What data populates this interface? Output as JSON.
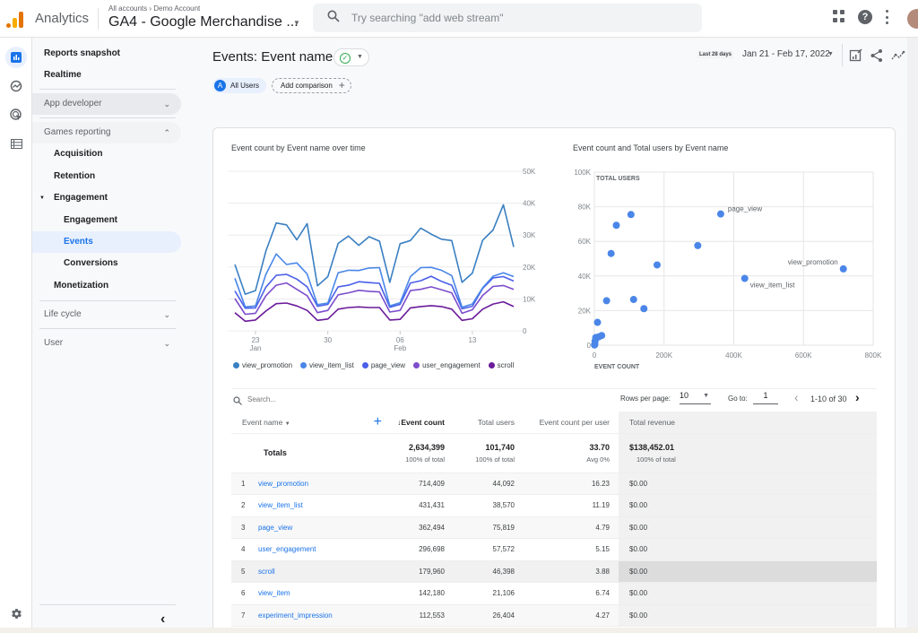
{
  "topbar": {
    "app_name": "Analytics",
    "breadcrumb": "All accounts › Demo Account",
    "property": "GA4 - Google Merchandise ...",
    "search_placeholder": "Try searching \"add web stream\"",
    "help_glyph": "?"
  },
  "rail": {
    "items": [
      {
        "icon": "reports-icon",
        "active": true
      },
      {
        "icon": "explore-icon",
        "active": false
      },
      {
        "icon": "advertising-icon",
        "active": false
      },
      {
        "icon": "configure-icon",
        "active": false
      }
    ],
    "settings_icon": "gear-icon"
  },
  "nav": {
    "reports_snapshot": "Reports snapshot",
    "realtime": "Realtime",
    "app_developer": "App developer",
    "games_reporting": "Games reporting",
    "acquisition": "Acquisition",
    "retention": "Retention",
    "engagement_group": "Engagement",
    "engagement": "Engagement",
    "events": "Events",
    "conversions": "Conversions",
    "monetization": "Monetization",
    "life_cycle": "Life cycle",
    "user": "User",
    "collapse_glyph": "‹"
  },
  "header": {
    "title": "Events: Event name",
    "segment_letter": "A",
    "segment": "All Users",
    "add_comparison": "Add comparison",
    "date_tag": "Last 28 days",
    "date_range": "Jan 21 - Feb 17, 2022"
  },
  "chart_data": [
    {
      "type": "line",
      "title": "Event count by Event name over time",
      "xlabel": "",
      "ylabel": "",
      "ylim": [
        0,
        50000
      ],
      "yticks": [
        "0",
        "10K",
        "20K",
        "30K",
        "40K",
        "50K"
      ],
      "xticks": [
        {
          "day_index": 2,
          "label": "23",
          "sub": "Jan"
        },
        {
          "day_index": 9,
          "label": "30",
          "sub": ""
        },
        {
          "day_index": 16,
          "label": "06",
          "sub": "Feb"
        },
        {
          "day_index": 23,
          "label": "13",
          "sub": ""
        }
      ],
      "x": [
        "Jan 21",
        "Jan 22",
        "Jan 23",
        "Jan 24",
        "Jan 25",
        "Jan 26",
        "Jan 27",
        "Jan 28",
        "Jan 29",
        "Jan 30",
        "Jan 31",
        "Feb 1",
        "Feb 2",
        "Feb 3",
        "Feb 4",
        "Feb 5",
        "Feb 6",
        "Feb 7",
        "Feb 8",
        "Feb 9",
        "Feb 10",
        "Feb 11",
        "Feb 12",
        "Feb 13",
        "Feb 14",
        "Feb 15",
        "Feb 16",
        "Feb 17"
      ],
      "grid": true,
      "legend_position": "bottom",
      "series": [
        {
          "name": "view_promotion",
          "color": "#3a7fc1",
          "values": [
            20800,
            11500,
            12600,
            25000,
            33800,
            33200,
            28500,
            33600,
            14100,
            17000,
            27400,
            29700,
            26800,
            29500,
            28100,
            15200,
            27300,
            28300,
            32200,
            30300,
            28700,
            28300,
            15200,
            18100,
            28400,
            31600,
            39500,
            26300
          ]
        },
        {
          "name": "view_item_list",
          "color": "#4a86e8",
          "values": [
            16500,
            7500,
            7800,
            17700,
            24100,
            20800,
            21300,
            17800,
            8200,
            8700,
            18200,
            19000,
            18900,
            19700,
            19800,
            7800,
            8800,
            17000,
            19800,
            19900,
            19000,
            17300,
            7400,
            8400,
            13500,
            17100,
            18200,
            17000
          ]
        },
        {
          "name": "page_view",
          "color": "#4a5fe8",
          "values": [
            12500,
            7100,
            7200,
            13700,
            17400,
            17700,
            16200,
            13800,
            7700,
            8300,
            13800,
            14300,
            15400,
            15100,
            14900,
            7400,
            8300,
            15000,
            15700,
            17100,
            15500,
            14300,
            6900,
            7700,
            13300,
            16600,
            17000,
            15600
          ]
        },
        {
          "name": "user_engagement",
          "color": "#7c4dcc",
          "values": [
            10100,
            5200,
            5500,
            11000,
            14300,
            15000,
            13000,
            11000,
            5700,
            6400,
            11300,
            11900,
            12700,
            12400,
            12200,
            5900,
            6400,
            12600,
            13000,
            13800,
            12900,
            11900,
            5500,
            6600,
            11100,
            13900,
            14200,
            13000
          ]
        },
        {
          "name": "scroll",
          "color": "#6a1b9a",
          "values": [
            5700,
            3000,
            3400,
            6200,
            8500,
            8700,
            7800,
            6400,
            3300,
            3700,
            6800,
            7300,
            7500,
            7300,
            7300,
            3400,
            3600,
            7200,
            7600,
            7900,
            7600,
            6800,
            3300,
            3800,
            6800,
            8400,
            9100,
            7600
          ]
        }
      ]
    },
    {
      "type": "scatter",
      "title": "Event count and Total users by Event name",
      "xlabel": "EVENT COUNT",
      "ylabel": "TOTAL USERS",
      "xlim": [
        0,
        800000
      ],
      "ylim": [
        0,
        100000
      ],
      "xticks": [
        "0",
        "200K",
        "400K",
        "600K",
        "800K"
      ],
      "yticks": [
        "0",
        "20K",
        "40K",
        "60K",
        "80K",
        "100K"
      ],
      "grid": true,
      "color": "#4a86e8",
      "points": [
        {
          "x": 714409,
          "y": 44092,
          "label": "view_promotion"
        },
        {
          "x": 431431,
          "y": 38570,
          "label": "view_item_list"
        },
        {
          "x": 362494,
          "y": 75819,
          "label": "page_view"
        },
        {
          "x": 296698,
          "y": 57572,
          "label": ""
        },
        {
          "x": 179960,
          "y": 46398,
          "label": ""
        },
        {
          "x": 142180,
          "y": 21106,
          "label": ""
        },
        {
          "x": 112553,
          "y": 26404,
          "label": ""
        },
        {
          "x": 105000,
          "y": 75500,
          "label": ""
        },
        {
          "x": 63000,
          "y": 69300,
          "label": ""
        },
        {
          "x": 48000,
          "y": 53000,
          "label": ""
        },
        {
          "x": 35000,
          "y": 25700,
          "label": ""
        },
        {
          "x": 9000,
          "y": 13200,
          "label": ""
        },
        {
          "x": 21000,
          "y": 5600,
          "label": ""
        },
        {
          "x": 12000,
          "y": 4800,
          "label": ""
        },
        {
          "x": 4000,
          "y": 4400,
          "label": ""
        },
        {
          "x": 2000,
          "y": 2500,
          "label": ""
        },
        {
          "x": 1500,
          "y": 800,
          "label": ""
        },
        {
          "x": 800,
          "y": 300,
          "label": ""
        },
        {
          "x": 500,
          "y": 100,
          "label": ""
        }
      ]
    }
  ],
  "table": {
    "search_placeholder": "Search...",
    "rows_per_page_label": "Rows per page:",
    "rows_per_page": "10",
    "goto_label": "Go to:",
    "goto_value": "1",
    "page_info": "1-10 of 30",
    "columns": [
      "Event name",
      "Event count",
      "Total users",
      "Event count per user",
      "Total revenue"
    ],
    "totals_label": "Totals",
    "totals": [
      {
        "value": "2,634,399",
        "sub": "100% of total"
      },
      {
        "value": "101,740",
        "sub": "100% of total"
      },
      {
        "value": "33.70",
        "sub": "Avg 0%"
      },
      {
        "value": "$138,452.01",
        "sub": "100% of total"
      }
    ],
    "rows": [
      {
        "n": "1",
        "event": "view_promotion",
        "count": "714,409",
        "users": "44,092",
        "per_user": "16.23",
        "revenue": "$0.00"
      },
      {
        "n": "2",
        "event": "view_item_list",
        "count": "431,431",
        "users": "38,570",
        "per_user": "11.19",
        "revenue": "$0.00"
      },
      {
        "n": "3",
        "event": "page_view",
        "count": "362,494",
        "users": "75,819",
        "per_user": "4.79",
        "revenue": "$0.00"
      },
      {
        "n": "4",
        "event": "user_engagement",
        "count": "296,698",
        "users": "57,572",
        "per_user": "5.15",
        "revenue": "$0.00"
      },
      {
        "n": "5",
        "event": "scroll",
        "count": "179,960",
        "users": "46,398",
        "per_user": "3.88",
        "revenue": "$0.00"
      },
      {
        "n": "6",
        "event": "view_item",
        "count": "142,180",
        "users": "21,106",
        "per_user": "6.74",
        "revenue": "$0.00"
      },
      {
        "n": "7",
        "event": "experiment_impression",
        "count": "112,553",
        "users": "26,404",
        "per_user": "4.27",
        "revenue": "$0.00"
      }
    ]
  }
}
